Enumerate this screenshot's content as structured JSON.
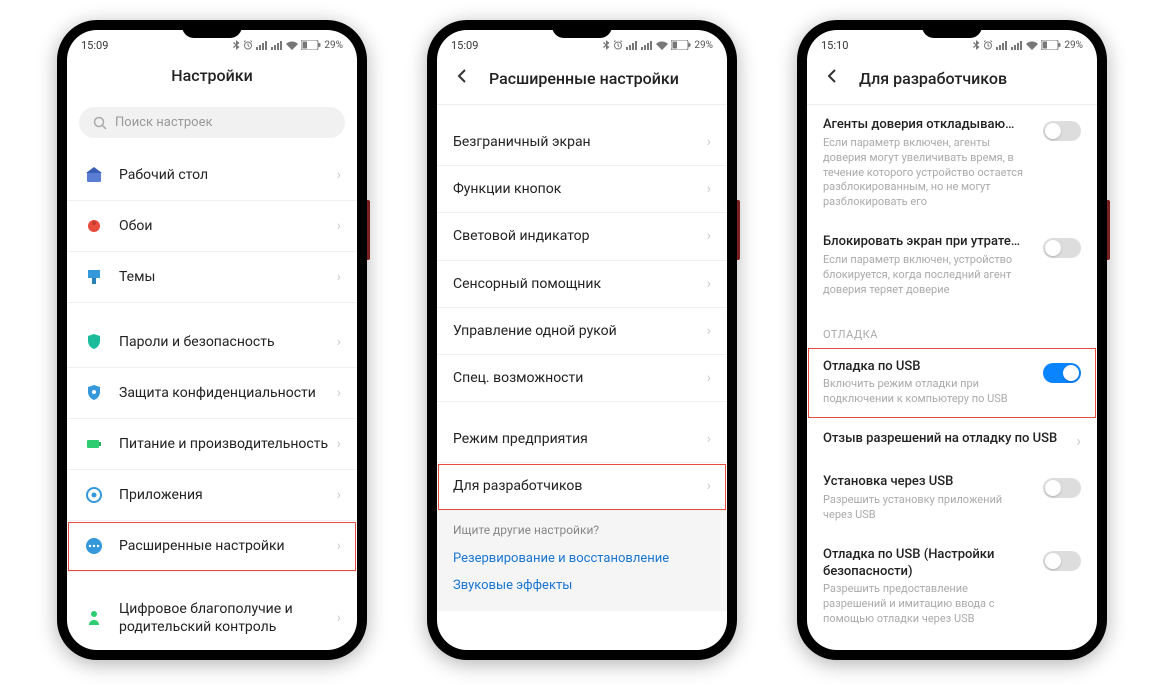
{
  "phones": [
    {
      "status": {
        "time": "15:09",
        "battery": "29"
      },
      "header": {
        "title": "Настройки"
      },
      "search_placeholder": "Поиск настроек",
      "items_top": [
        {
          "label": "Рабочий стол",
          "icon": "home"
        },
        {
          "label": "Обои",
          "icon": "wallpaper"
        },
        {
          "label": "Темы",
          "icon": "themes"
        }
      ],
      "items_mid": [
        {
          "label": "Пароли и безопасность",
          "icon": "security"
        },
        {
          "label": "Защита конфиденциальности",
          "icon": "privacy"
        },
        {
          "label": "Питание и производительность",
          "icon": "battery"
        },
        {
          "label": "Приложения",
          "icon": "apps"
        },
        {
          "label": "Расширенные настройки",
          "icon": "advanced",
          "highlighted": true
        }
      ],
      "items_bottom": [
        {
          "label": "Цифровое благополучие и родительский контроль",
          "icon": "wellbeing"
        }
      ]
    },
    {
      "status": {
        "time": "15:09",
        "battery": "29"
      },
      "header": {
        "title": "Расширенные настройки"
      },
      "items_top": [
        {
          "label": "Безграничный экран"
        },
        {
          "label": "Функции кнопок"
        },
        {
          "label": "Световой индикатор"
        },
        {
          "label": "Сенсорный помощник"
        },
        {
          "label": "Управление одной рукой"
        },
        {
          "label": "Спец. возможности"
        }
      ],
      "items_mid": [
        {
          "label": "Режим предприятия"
        },
        {
          "label": "Для разработчиков",
          "highlighted": true
        }
      ],
      "footer": {
        "title": "Ищите другие настройки?",
        "links": [
          "Резервирование и восстановление",
          "Звуковые эффекты"
        ]
      }
    },
    {
      "status": {
        "time": "15:10",
        "battery": "29"
      },
      "header": {
        "title": "Для разработчиков"
      },
      "settings_top": [
        {
          "title": "Агенты доверия откладываю…",
          "desc": "Если параметр включен, агенты доверия могут увеличивать время, в течение которого устройство остается разблокированным, но не могут разблокировать его",
          "toggle": false
        },
        {
          "title": "Блокировать экран при утрате…",
          "desc": "Если параметр включен, устройство блокируется, когда последний агент доверия теряет доверие",
          "toggle": false
        }
      ],
      "section": "ОТЛАДКА",
      "settings_debug": [
        {
          "title": "Отладка по USB",
          "desc": "Включить режим отладки при подключении к компьютеру по USB",
          "toggle": true,
          "highlighted": true
        },
        {
          "title": "Отзыв разрешений на отладку по USB",
          "chevron": true
        },
        {
          "title": "Установка через USB",
          "desc": "Разрешить установку приложений через USB",
          "toggle": false
        },
        {
          "title": "Отладка по USB (Настройки безопасности)",
          "desc": "Разрешить предоставление разрешений и имитацию ввода с помощью отладки через USB",
          "toggle": false
        }
      ]
    }
  ]
}
